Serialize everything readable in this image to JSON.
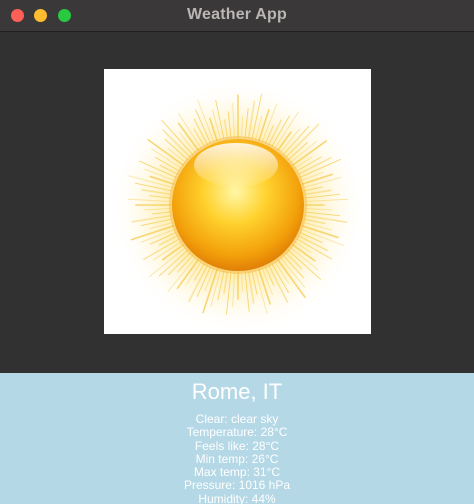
{
  "window": {
    "title": "Weather App",
    "controls": {
      "close_color": "#ff5f57",
      "minimize_color": "#febc2e",
      "maximize_color": "#28c840"
    }
  },
  "weather_icon": {
    "icon": "sun-icon"
  },
  "info": {
    "city": "Rome, IT",
    "details": [
      "Clear: clear sky",
      "Temperature: 28°C",
      "Feels like: 28°C",
      "Min temp: 26°C",
      "Max temp: 31°C",
      "Pressure: 1016 hPa",
      "Humidity: 44%"
    ]
  },
  "colors": {
    "info_panel_bg": "#b5d8e6",
    "window_bg": "#313131"
  }
}
